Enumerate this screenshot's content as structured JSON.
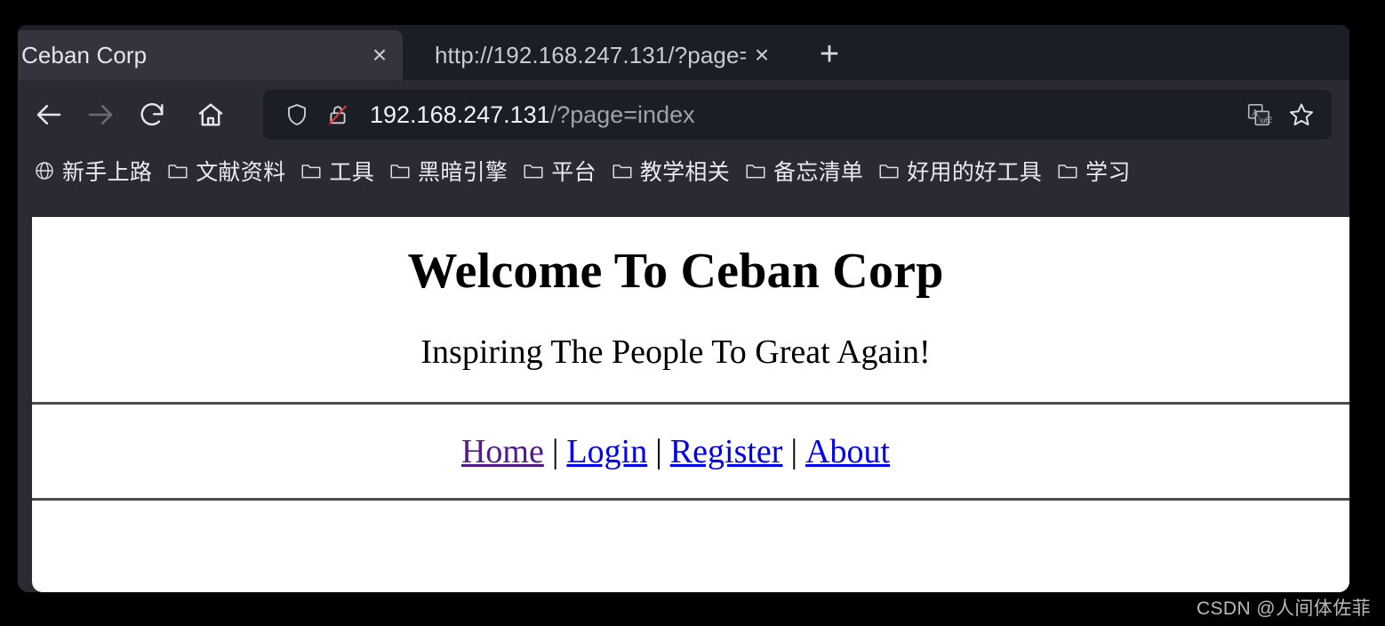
{
  "browser": {
    "tabs": [
      {
        "title": "Ceban Corp",
        "active": true,
        "close_label": "×"
      },
      {
        "title": "http://192.168.247.131/?page=",
        "active": false,
        "close_label": "×"
      }
    ],
    "new_tab_label": "+",
    "toolbar": {
      "back_label": "back-arrow",
      "forward_label": "forward-arrow",
      "reload_label": "reload-arrow",
      "home_label": "home-house"
    },
    "url_bar": {
      "host": "192.168.247.131",
      "path": "/?page=index",
      "shield_label": "tracking-protection-shield",
      "lock_label": "insecure-connection-lock",
      "translate_label": "translate-page",
      "bookmark_label": "bookmark-star"
    },
    "bookmarks": [
      {
        "label": "新手上路",
        "icon": "globe"
      },
      {
        "label": "文献资料",
        "icon": "folder"
      },
      {
        "label": "工具",
        "icon": "folder"
      },
      {
        "label": "黑暗引擎",
        "icon": "folder"
      },
      {
        "label": "平台",
        "icon": "folder"
      },
      {
        "label": "教学相关",
        "icon": "folder"
      },
      {
        "label": "备忘清单",
        "icon": "folder"
      },
      {
        "label": "好用的好工具",
        "icon": "folder"
      },
      {
        "label": "学习",
        "icon": "folder"
      }
    ]
  },
  "page": {
    "title": "Welcome To Ceban Corp",
    "tagline": "Inspiring The People To Great Again!",
    "nav": {
      "separator": "|",
      "links": [
        {
          "label": "Home",
          "state": "visited"
        },
        {
          "label": "Login",
          "state": "unvisited"
        },
        {
          "label": "Register",
          "state": "unvisited"
        },
        {
          "label": "About",
          "state": "unvisited"
        }
      ]
    }
  },
  "watermark": "CSDN @人间体佐菲",
  "colors": {
    "tabbar_bg": "#1c1e26",
    "toolbar_bg": "#2b2a33",
    "active_tab_bg": "#34343f",
    "link": "#0000ee",
    "visited_link": "#551a8b",
    "rule": "#4d4d4d",
    "insecure_lock": "#e2323b"
  }
}
